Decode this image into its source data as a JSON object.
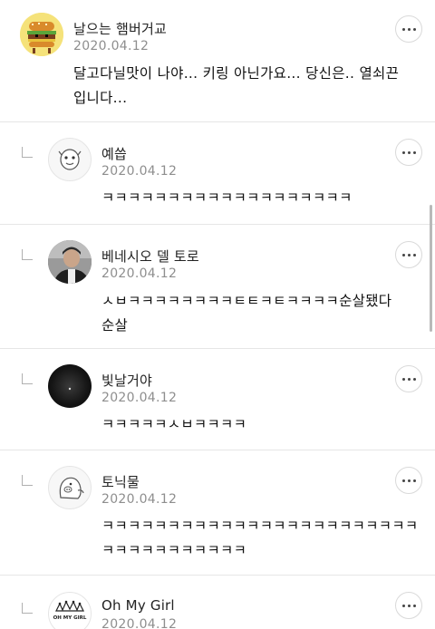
{
  "comments": [
    {
      "author": "날으는 햄버거교",
      "date": "2020.04.12",
      "text_line1": "달고다닐맛이 나야... 키링 아닌가요... 당신은.. 열쇠끈",
      "text_line2": "입니다..."
    },
    {
      "author": "예씁",
      "date": "2020.04.12",
      "text_line1": "ㅋㅋㅋㅋㅋㅋㅋㅋㅋㅋㅋㅋㅋㅋㅋㅋㅋㅋㅋ"
    },
    {
      "author": "베네시오 델 토로",
      "date": "2020.04.12",
      "text_line1": "ㅅㅂㅋㅋㅋㅋㅋㅋㅋㅋㅌㅌㅋㅌㅋㅋㅋㅋ순살됐다",
      "text_line2": "순살"
    },
    {
      "author": "빛날거야",
      "date": "2020.04.12",
      "text_line1": "ㅋㅋㅋㅋㅋㅅㅂㅋㅋㅋㅋ"
    },
    {
      "author": "토닉물",
      "date": "2020.04.12",
      "text_line1": "ㅋㅋㅋㅋㅋㅋㅋㅋㅋㅋㅋㅋㅋㅋㅋㅋㅋㅋㅋㅋㅋㅋㅋㅋ",
      "text_line2": "ㅋㅋㅋㅋㅋㅋㅋㅋㅋㅋㅋ"
    },
    {
      "author": "Oh My Girl",
      "date": "2020.04.12",
      "avatar_logo_text": "OH MY GIRL"
    }
  ]
}
